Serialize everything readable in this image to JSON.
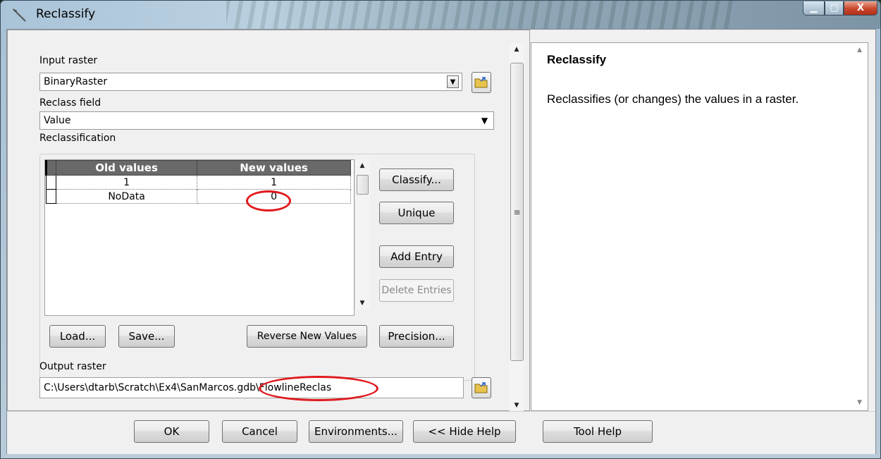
{
  "window": {
    "title": "Reclassify",
    "minimize_glyph": "▁",
    "maximize_glyph": "▢",
    "close_glyph": "X"
  },
  "form": {
    "input_raster_label": "Input raster",
    "input_raster_value": "BinaryRaster",
    "reclass_field_label": "Reclass field",
    "reclass_field_value": "Value",
    "reclassification_label": "Reclassification",
    "output_raster_label": "Output raster",
    "output_raster_value": "C:\\Users\\dtarb\\Scratch\\Ex4\\SanMarcos.gdb\\FlowlineReclas"
  },
  "table": {
    "headers": [
      "Old values",
      "New values"
    ],
    "rows": [
      {
        "old": "1",
        "new": "1"
      },
      {
        "old": "NoData",
        "new": "0"
      }
    ]
  },
  "side_buttons": {
    "classify": "Classify...",
    "unique": "Unique",
    "add_entry": "Add Entry",
    "delete_entries": "Delete Entries"
  },
  "lower_buttons": {
    "load": "Load...",
    "save": "Save...",
    "reverse": "Reverse New Values",
    "precision": "Precision..."
  },
  "help": {
    "title": "Reclassify",
    "text": "Reclassifies (or changes) the values in a raster."
  },
  "dialog_buttons": {
    "ok": "OK",
    "cancel": "Cancel",
    "environments": "Environments...",
    "hide_help": "<< Hide Help",
    "tool_help": "Tool Help"
  },
  "colors": {
    "annotation": "#e0191d",
    "header_bg": "#696969"
  }
}
